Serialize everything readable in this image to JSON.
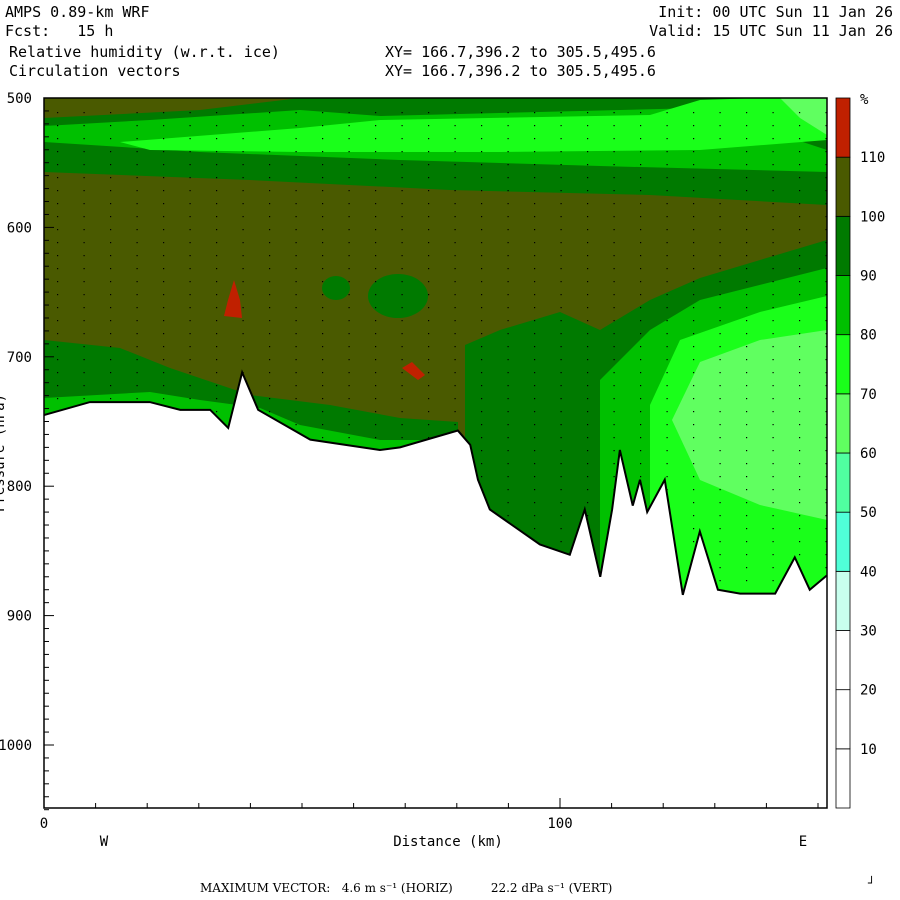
{
  "header": {
    "model": "AMPS 0.89-km WRF",
    "fcst": "Fcst:   15 h",
    "init": "Init: 00 UTC Sun 11 Jan 26",
    "valid": "Valid: 15 UTC Sun 11 Jan 26",
    "field1": "Relative humidity (w.r.t. ice)",
    "field1_xy": "XY= 166.7,396.2 to 305.5,495.6",
    "field2": "Circulation vectors",
    "field2_xy": "XY= 166.7,396.2 to 305.5,495.6"
  },
  "footer": {
    "max_vector": "MAXIMUM VECTOR:   4.6 m s⁻¹ (HORIZ)          22.2 dPa s⁻¹ (VERT)",
    "corner_mark": "┘"
  },
  "chart_data": {
    "type": "heatmap",
    "title": "Relative humidity (w.r.t. ice) cross-section",
    "xlabel": "Distance (km)",
    "ylabel": "Pressure (hPa)",
    "xlim": [
      0,
      151.7
    ],
    "ylim": [
      1050,
      500
    ],
    "x_ticks": [
      0,
      100
    ],
    "x_tick_labels": [
      "0",
      "100"
    ],
    "y_ticks": [
      500,
      600,
      700,
      800,
      900,
      1000
    ],
    "y_tick_labels": [
      "500",
      "600",
      "700",
      "800",
      "900",
      "1000"
    ],
    "west_label": "W",
    "east_label": "E",
    "colorbar": {
      "unit": "%",
      "levels": [
        10,
        20,
        30,
        40,
        50,
        60,
        70,
        80,
        90,
        100,
        110
      ],
      "level_labels": [
        "10",
        "20",
        "30",
        "40",
        "50",
        "60",
        "70",
        "80",
        "90",
        "100",
        "110"
      ],
      "colors": [
        "#ffffff",
        "#ffffff",
        "#ffffff",
        "#c8ffee",
        "#50ffd8",
        "#50ffa0",
        "#60ff60",
        "#1aff1a",
        "#00c000",
        "#007a00",
        "#4a5a00",
        "#c02000"
      ]
    },
    "terrain_km_hpa": [
      [
        0,
        745
      ],
      [
        8.9,
        735
      ],
      [
        20.5,
        735
      ],
      [
        26.4,
        741
      ],
      [
        32.2,
        741
      ],
      [
        35.7,
        755
      ],
      [
        38.4,
        712
      ],
      [
        41.5,
        741
      ],
      [
        51.6,
        764
      ],
      [
        65.1,
        772
      ],
      [
        69.0,
        770
      ],
      [
        80.2,
        757
      ],
      [
        82.6,
        768
      ],
      [
        84.1,
        795
      ],
      [
        86.4,
        818
      ],
      [
        96.1,
        845
      ],
      [
        101.9,
        853
      ],
      [
        104.8,
        818
      ],
      [
        107.8,
        870
      ],
      [
        110.1,
        818
      ],
      [
        111.6,
        772
      ],
      [
        114.1,
        815
      ],
      [
        115.5,
        795
      ],
      [
        116.9,
        820
      ],
      [
        120.3,
        795
      ],
      [
        123.8,
        884
      ],
      [
        127.1,
        835
      ],
      [
        130.6,
        880
      ],
      [
        134.9,
        883
      ],
      [
        141.7,
        883
      ],
      [
        145.5,
        855
      ],
      [
        148.4,
        880
      ],
      [
        151.7,
        869
      ]
    ]
  }
}
